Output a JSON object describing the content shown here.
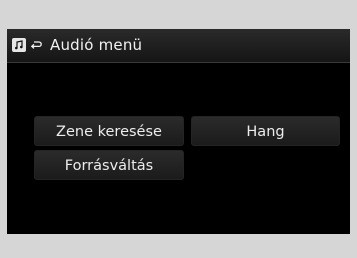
{
  "header": {
    "title": "Audió menü",
    "icons": [
      "music-note-icon",
      "back-arrow-icon"
    ]
  },
  "menu": {
    "items": [
      {
        "label": "Zene keresése"
      },
      {
        "label": "Hang"
      },
      {
        "label": "Forrásváltás"
      }
    ]
  },
  "colors": {
    "screen_bg": "#000000",
    "frame_bg": "#d6d6d6",
    "text": "#ececec",
    "button_bg": "#222222"
  }
}
